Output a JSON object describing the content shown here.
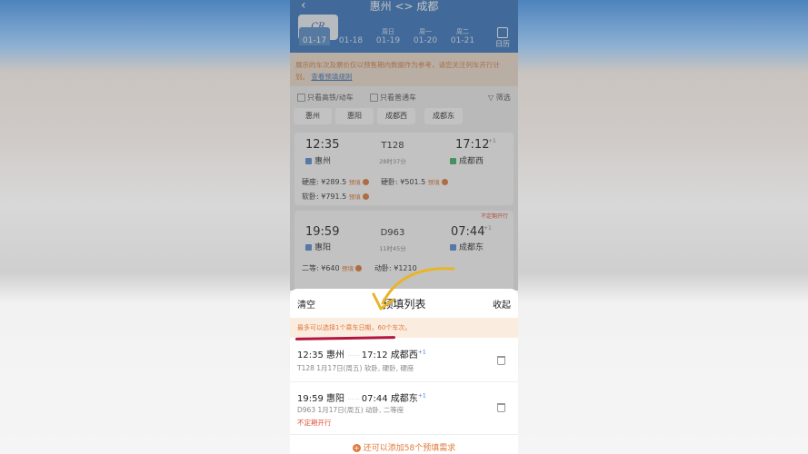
{
  "header": {
    "back": "‹",
    "route": "惠州 <> 成都",
    "logo": "中国铁路",
    "dates": [
      {
        "week": "",
        "date": "01-17",
        "selected": true
      },
      {
        "week": "",
        "date": "01-18",
        "selected": false
      },
      {
        "week": "周日",
        "date": "01-19",
        "selected": false
      },
      {
        "week": "周一",
        "date": "01-20",
        "selected": false
      },
      {
        "week": "周二",
        "date": "01-21",
        "selected": false
      }
    ],
    "calendar_label": "日历"
  },
  "notice": {
    "text": "展示的车次及票价仅以预售期内数据作为参考，请您关注列车开行计划。",
    "link": "查看预填规则"
  },
  "filters": {
    "high_speed": "只看高铁/动车",
    "regular": "只看普通车",
    "filter": "筛选"
  },
  "chips": [
    "惠州",
    "惠阳",
    "成都西",
    "成都东"
  ],
  "trains": [
    {
      "depart": "12:35",
      "from": "惠州",
      "no": "T128",
      "duration": "28时37分",
      "arrive": "17:12",
      "to": "成都西",
      "plus": "+1",
      "seats": [
        {
          "label": "硬座: ¥289.5",
          "tag": "预填"
        },
        {
          "label": "硬卧: ¥501.5",
          "tag": "预填"
        },
        {
          "label": "软卧: ¥791.5",
          "tag": "预填"
        }
      ]
    },
    {
      "note": "不定期开行",
      "depart": "19:59",
      "from": "惠阳",
      "no": "D963",
      "duration": "11时45分",
      "arrive": "07:44",
      "to": "成都东",
      "plus": "+1",
      "seats": [
        {
          "label": "二等: ¥640",
          "tag": "预填"
        },
        {
          "label": "动卧: ¥1210",
          "tag": ""
        }
      ]
    }
  ],
  "sheet": {
    "clear": "清空",
    "title": "预填列表",
    "collapse": "收起",
    "hint": "最多可以选择1个乘车日期，60个车次。",
    "items": [
      {
        "depart": "12:35",
        "from": "惠州",
        "arrive": "17:12",
        "to": "成都西",
        "plus": "+1",
        "sub": "T128 1月17日(周五) 软卧, 硬卧, 硬座",
        "warn": ""
      },
      {
        "depart": "19:59",
        "from": "惠阳",
        "arrive": "07:44",
        "to": "成都东",
        "plus": "+1",
        "sub": "D963 1月17日(周五) 动卧, 二等座",
        "warn": "不定期开行"
      }
    ],
    "footer": "还可以添加58个预填需求"
  },
  "colors": {
    "header": "#3a78c2",
    "accent": "#e07a3a",
    "annotation": "#b3163e",
    "arrow": "#e8b428"
  }
}
